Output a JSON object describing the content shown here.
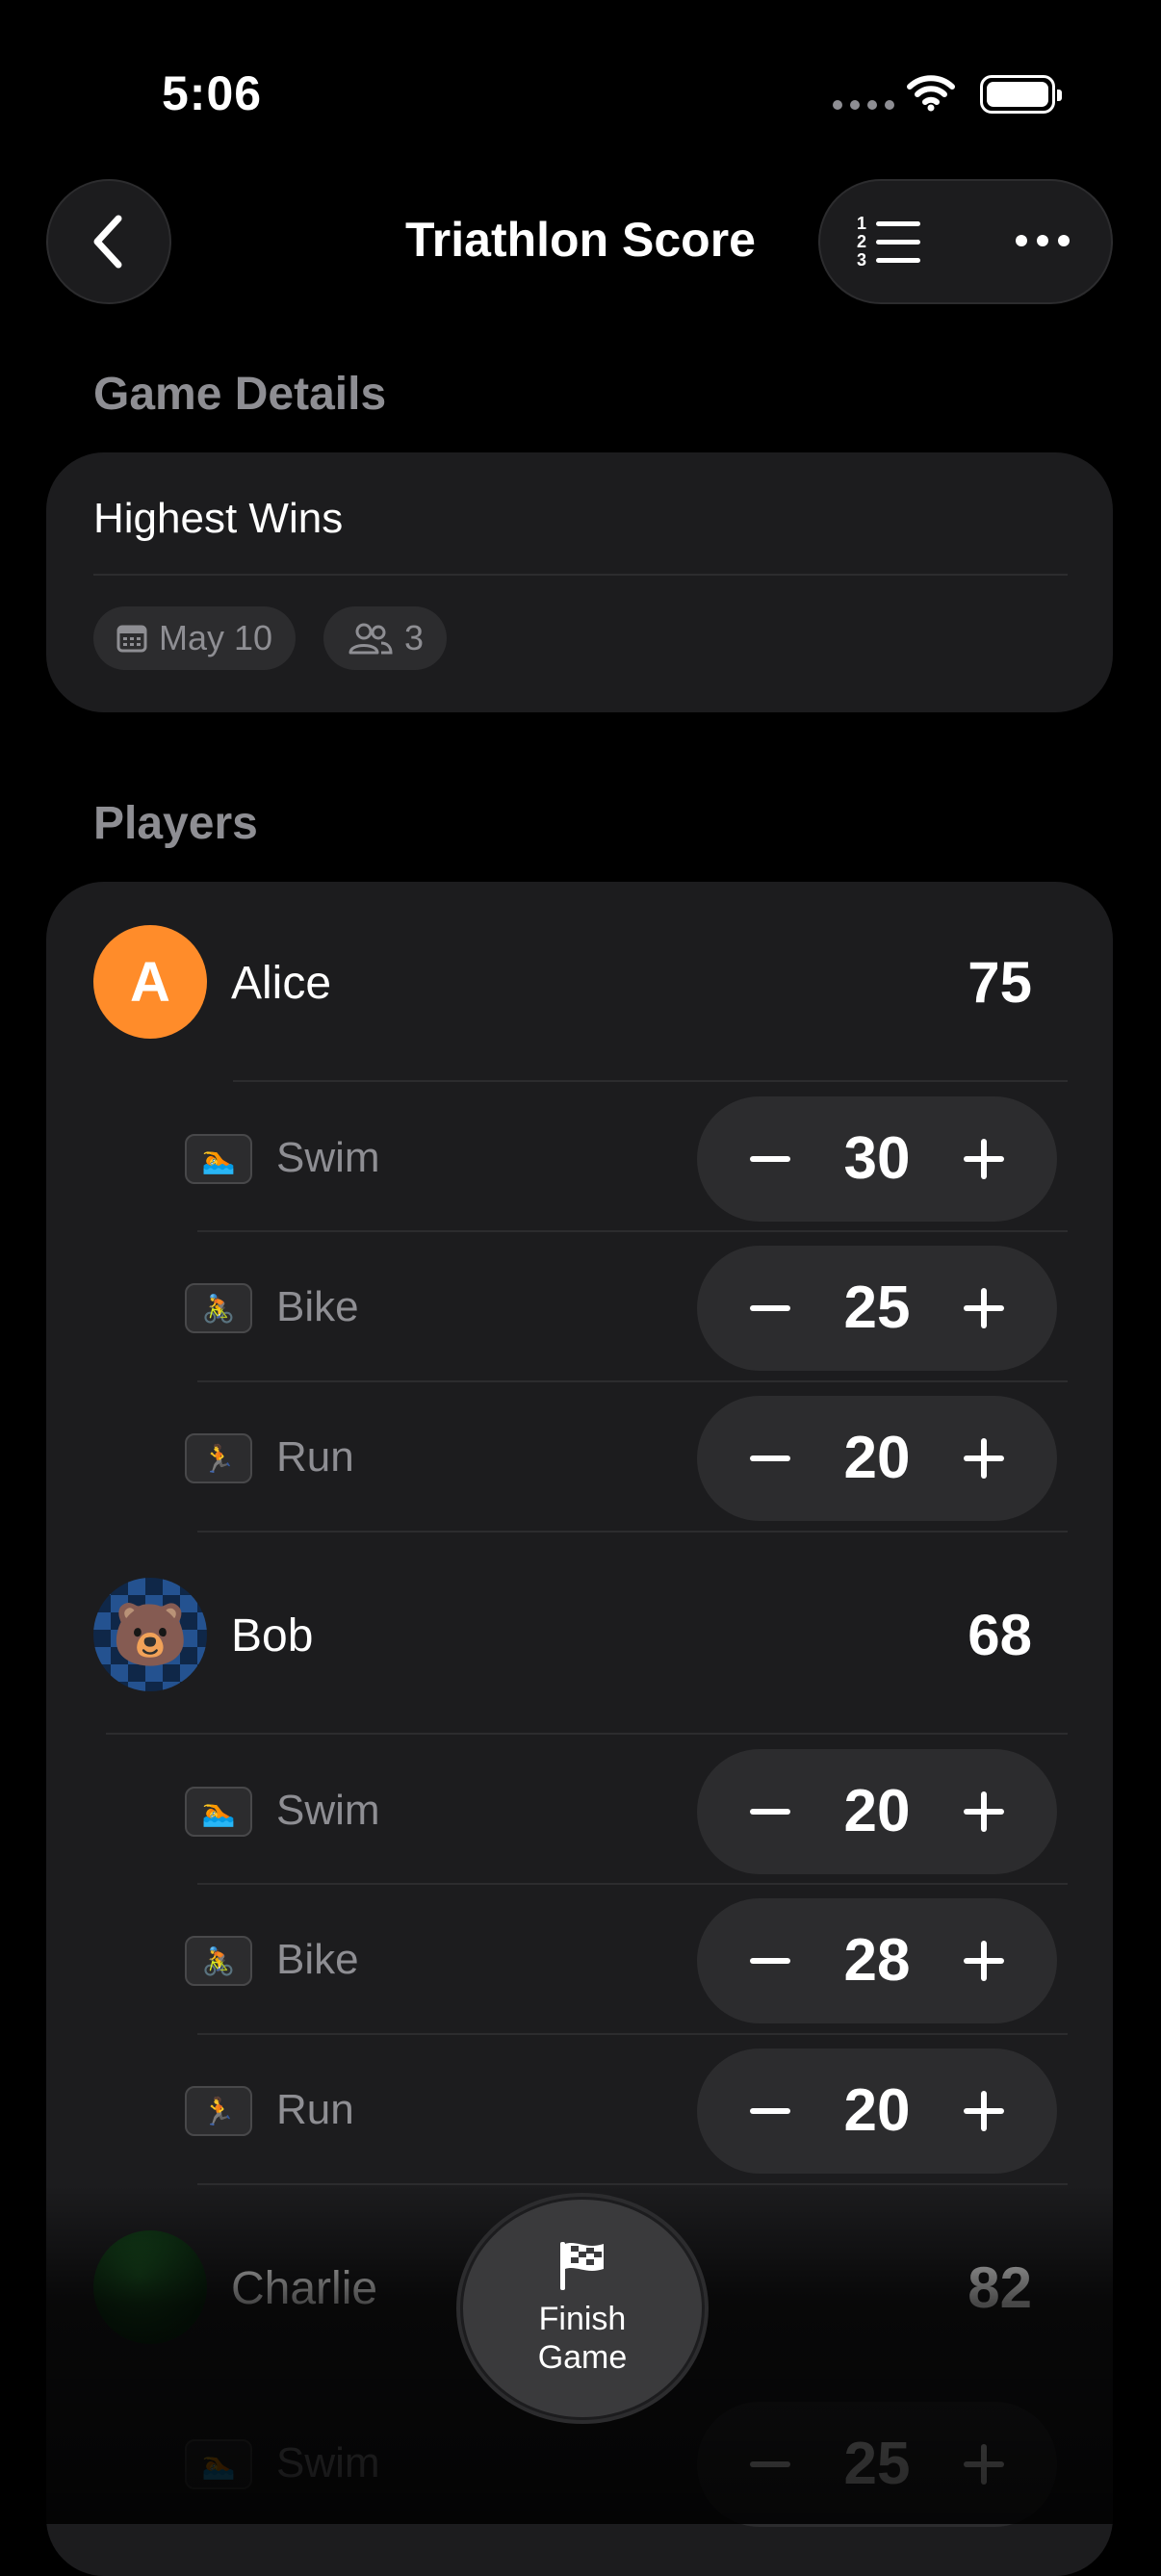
{
  "status": {
    "time": "5:06"
  },
  "nav": {
    "title": "Triathlon Score"
  },
  "details": {
    "section_title": "Game Details",
    "mode": "Highest Wins",
    "date": "May 10",
    "player_count": "3"
  },
  "players_section": {
    "title": "Players"
  },
  "players": [
    {
      "name": "Alice",
      "initial": "A",
      "total": "75",
      "events": [
        {
          "label": "Swim",
          "value": "30"
        },
        {
          "label": "Bike",
          "value": "25"
        },
        {
          "label": "Run",
          "value": "20"
        }
      ]
    },
    {
      "name": "Bob",
      "avatar_emoji": "🐻",
      "total": "68",
      "events": [
        {
          "label": "Swim",
          "value": "20"
        },
        {
          "label": "Bike",
          "value": "28"
        },
        {
          "label": "Run",
          "value": "20"
        }
      ]
    },
    {
      "name": "Charlie",
      "total": "82",
      "events": [
        {
          "label": "Swim",
          "value": "25"
        }
      ]
    }
  ],
  "finish": {
    "label": "Finish Game"
  },
  "colors": {
    "accent_orange": "#ff8c2a",
    "card": "#1c1c1e",
    "stepper": "#2c2c2e",
    "muted_text": "#8e8e93"
  }
}
